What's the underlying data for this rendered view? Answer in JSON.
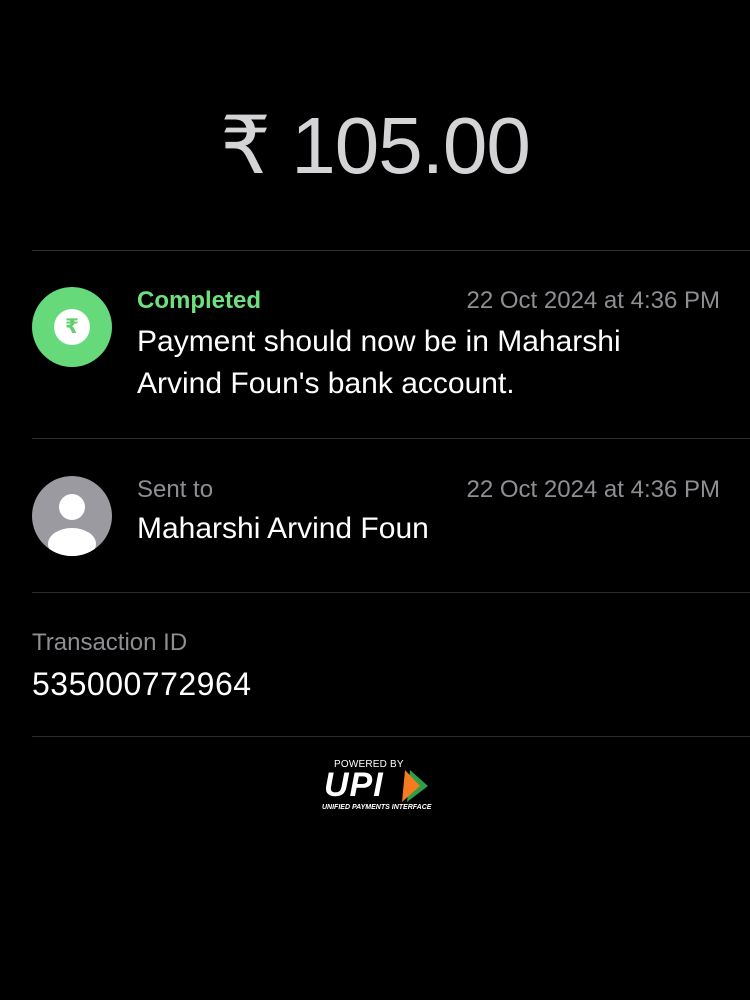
{
  "amount": "₹ 105.00",
  "status": {
    "label": "Completed",
    "timestamp": "22 Oct 2024 at 4:36 PM",
    "message": "Payment should now be in Maharshi Arvind Foun's bank account.",
    "icon": "rupee-icon",
    "color": "#66d97a"
  },
  "recipient": {
    "label": "Sent to",
    "timestamp": "22 Oct 2024 at 4:36 PM",
    "name": "Maharshi Arvind Foun",
    "icon": "person-avatar-icon"
  },
  "transaction": {
    "label": "Transaction ID",
    "id": "535000772964"
  },
  "upi": {
    "powered_by": "POWERED BY",
    "logo": "UPI",
    "subtitle": "UNIFIED PAYMENTS INTERFACE",
    "colors": [
      "#f47b20",
      "#2e9e47"
    ]
  }
}
